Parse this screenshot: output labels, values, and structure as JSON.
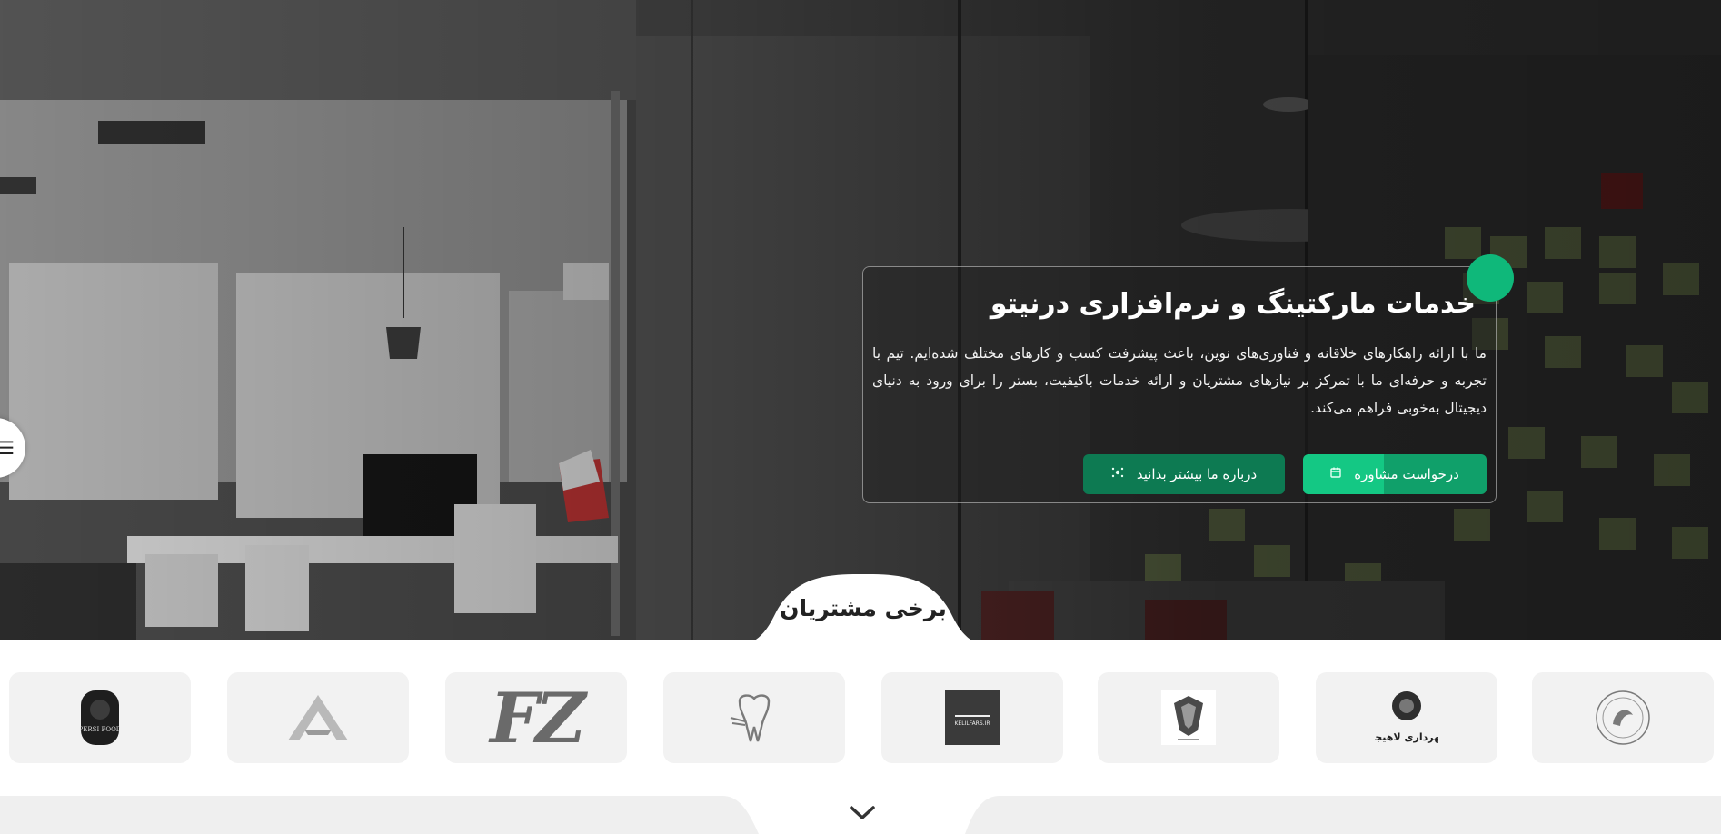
{
  "hero": {
    "title": "خدمات مارکتینگ و نرم‌افزاری درنیتو",
    "description": "ما با ارائه راهکارهای خلاقانه و فناوری‌های نوین، باعث پیشرفت کسب و کارهای مختلف شده‌ایم. تیم با تجربه و حرفه‌ای ما با تمرکز بر نیازهای مشتریان و ارائه خدمات باکیفیت، بستر را برای ورود به دنیای دیجیتال به‌خوبی فراهم می‌کند.",
    "primary_button": "درخواست مشاوره",
    "secondary_button": "درباره ما بیشتر بدانید",
    "primary_button_icon": "calendar-icon",
    "secondary_button_icon": "sparkle-icon",
    "accent_color": "#0fb87a"
  },
  "side_menu": {
    "icon": "menu-icon",
    "glyph": "☰"
  },
  "clients": {
    "title": "برخی مشتریان",
    "logos": [
      {
        "name": "persi-food-logo",
        "text": "PERSI FOOD"
      },
      {
        "name": "a-letter-logo",
        "text": ""
      },
      {
        "name": "fz-logo",
        "text": "FZ"
      },
      {
        "name": "dental-implant-logo",
        "text": ""
      },
      {
        "name": "kelilfars-logo",
        "text": "KELILFARS.IR"
      },
      {
        "name": "azad-university-logo",
        "text": ""
      },
      {
        "name": "lahijan-municipality-logo",
        "text": "شهرداری لاهیجان"
      },
      {
        "name": "round-emblem-logo",
        "text": ""
      }
    ]
  },
  "carousel": {
    "prev_icon": "chevron-left-icon",
    "next_icon": "chevron-right-icon",
    "prev_glyph": "‹",
    "next_glyph": "›"
  },
  "scroll_down": {
    "icon": "chevron-down-icon"
  }
}
